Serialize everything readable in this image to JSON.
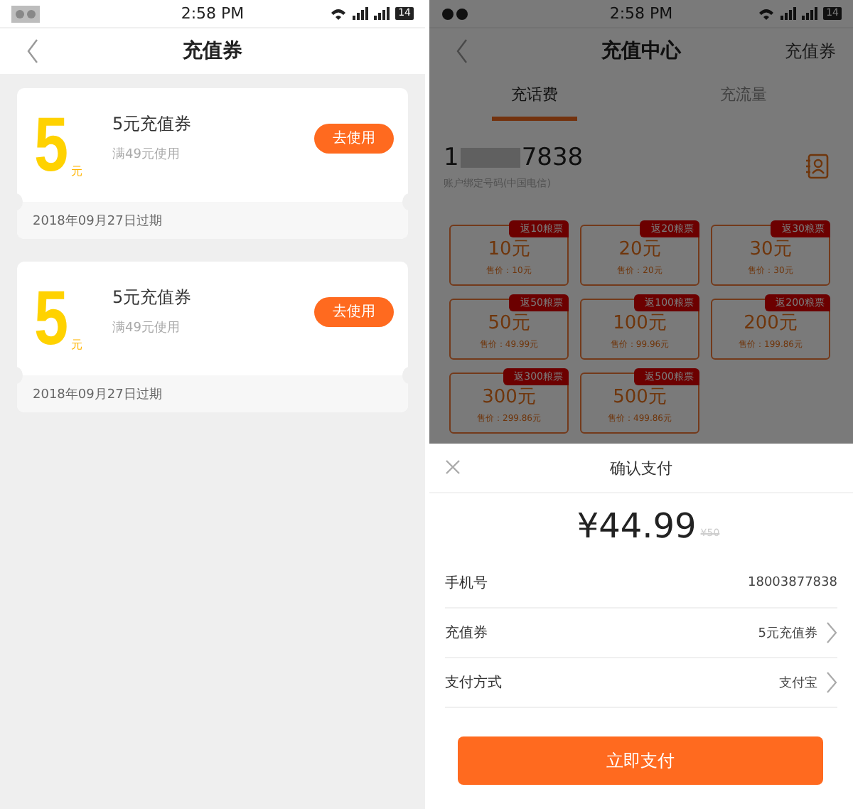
{
  "left_screen": {
    "status_bar": {
      "time": "2:58 PM",
      "battery": "14"
    },
    "header": {
      "title": "充值券"
    },
    "coupons": [
      {
        "amount": "5",
        "unit": "元",
        "title": "5元充值券",
        "condition": "满49元使用",
        "button": "去使用",
        "expiry": "2018年09月27日过期"
      },
      {
        "amount": "5",
        "unit": "元",
        "title": "5元充值券",
        "condition": "满49元使用",
        "button": "去使用",
        "expiry": "2018年09月27日过期"
      }
    ]
  },
  "right_screen": {
    "status_bar": {
      "time": "2:58 PM",
      "battery": "14"
    },
    "header": {
      "title": "充值中心",
      "action": "充值券"
    },
    "tabs": [
      {
        "label": "充话费",
        "selected": true
      },
      {
        "label": "充流量",
        "selected": false
      }
    ],
    "phone": {
      "prefix": "1",
      "suffix": "7838",
      "carrier": "账户绑定号码(中国电信)"
    },
    "options": [
      {
        "badge": "返10粮票",
        "amount": "10元",
        "price": "售价：10元"
      },
      {
        "badge": "返20粮票",
        "amount": "20元",
        "price": "售价：20元"
      },
      {
        "badge": "返30粮票",
        "amount": "30元",
        "price": "售价：30元"
      },
      {
        "badge": "返50粮票",
        "amount": "50元",
        "price": "售价：49.99元"
      },
      {
        "badge": "返100粮票",
        "amount": "100元",
        "price": "售价：99.96元"
      },
      {
        "badge": "返200粮票",
        "amount": "200元",
        "price": "售价：199.86元"
      },
      {
        "badge": "返300粮票",
        "amount": "300元",
        "price": "售价：299.86元"
      },
      {
        "badge": "返500粮票",
        "amount": "500元",
        "price": "售价：499.86元"
      }
    ],
    "payment_sheet": {
      "title": "确认支付",
      "price": "¥44.99",
      "original_price": "¥50",
      "rows": [
        {
          "label": "手机号",
          "value": "18003877838",
          "arrow": false
        },
        {
          "label": "充值券",
          "value": "5元充值券",
          "arrow": true
        },
        {
          "label": "支付方式",
          "value": "支付宝",
          "arrow": true
        }
      ],
      "button": "立即支付"
    }
  }
}
